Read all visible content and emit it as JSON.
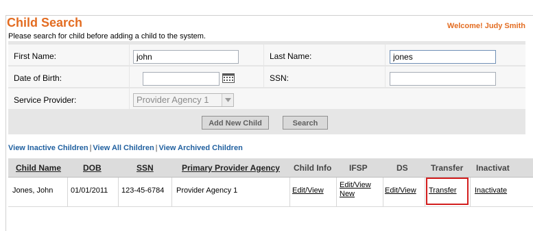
{
  "header": {
    "title": "Child Search",
    "welcome": "Welcome! Judy Smith",
    "instruction": "Please search for child before adding a child to the system."
  },
  "form": {
    "first_name": {
      "label": "First Name:",
      "value": "john"
    },
    "last_name": {
      "label": "Last Name:",
      "value": "jones"
    },
    "dob": {
      "label": "Date of Birth:",
      "value": ""
    },
    "ssn": {
      "label": "SSN:",
      "value": ""
    },
    "service_provider": {
      "label": "Service Provider:",
      "selected": "Provider Agency 1"
    },
    "add_button": "Add New Child",
    "search_button": "Search"
  },
  "links": {
    "inactive": "View Inactive Children",
    "all": "View All Children",
    "archived": "View Archived Children",
    "separator": "|"
  },
  "table": {
    "headers": [
      "Child Name",
      "DOB",
      "SSN",
      "Primary Provider Agency",
      "Child Info",
      "IFSP",
      "DS",
      "Transfer",
      "Inactivat"
    ],
    "rows": [
      {
        "child_name": "Jones, John",
        "dob": "01/01/2011",
        "ssn": "123-45-6784",
        "agency": "Provider Agency 1",
        "child_info": "Edit/View",
        "ifsp": "Edit/View New",
        "ds": "Edit/View",
        "transfer": "Transfer",
        "inactivate": "Inactivate"
      }
    ]
  },
  "colors": {
    "accent": "#e36c21",
    "link": "#1f5f9f",
    "highlight": "#d21c1c"
  }
}
